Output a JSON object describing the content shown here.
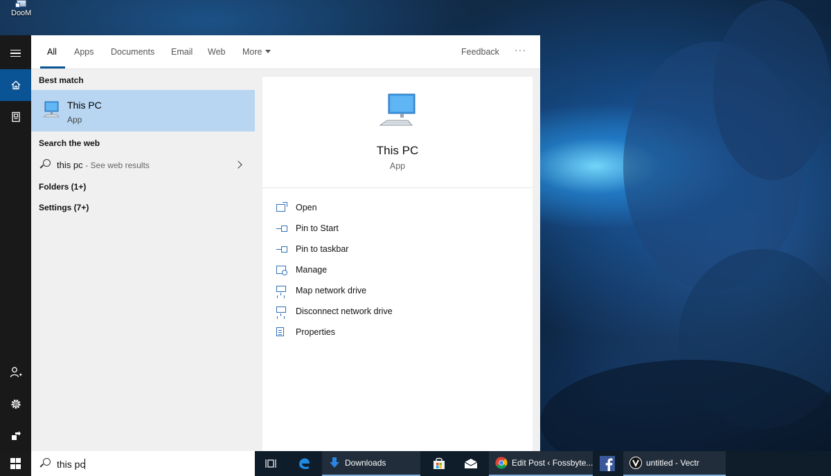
{
  "desktop": {
    "icons": [
      {
        "label": "DooM"
      }
    ]
  },
  "rail": {
    "items": [
      {
        "icon": "hamburger-icon"
      },
      {
        "icon": "home-icon",
        "active": true
      },
      {
        "icon": "notebook-icon"
      },
      {
        "icon": "add-user-icon"
      },
      {
        "icon": "gear-icon"
      },
      {
        "icon": "feedback-icon"
      }
    ]
  },
  "tabs": {
    "items": [
      {
        "label": "All",
        "active": true
      },
      {
        "label": "Apps"
      },
      {
        "label": "Documents"
      },
      {
        "label": "Email"
      },
      {
        "label": "Web"
      },
      {
        "label": "More"
      }
    ],
    "feedback_label": "Feedback",
    "overflow_label": "···"
  },
  "results": {
    "best_match_heading": "Best match",
    "best_match": {
      "name": "This PC",
      "type": "App"
    },
    "web_heading": "Search the web",
    "web_query": "this pc",
    "web_hint": "- See web results",
    "folders_label": "Folders (1+)",
    "settings_label": "Settings (7+)"
  },
  "detail": {
    "title": "This PC",
    "subtitle": "App",
    "actions": [
      {
        "label": "Open",
        "icon": "open-icon"
      },
      {
        "label": "Pin to Start",
        "icon": "pin-icon"
      },
      {
        "label": "Pin to taskbar",
        "icon": "pin-icon"
      },
      {
        "label": "Manage",
        "icon": "manage-icon"
      },
      {
        "label": "Map network drive",
        "icon": "network-drive-icon"
      },
      {
        "label": "Disconnect network drive",
        "icon": "network-drive-icon"
      },
      {
        "label": "Properties",
        "icon": "properties-icon"
      }
    ]
  },
  "taskbar": {
    "search_value": "this pc",
    "apps": [
      {
        "label": "Downloads",
        "icon": "download-arrow-icon"
      },
      {
        "label": "Edit Post ‹ Fossbyte...",
        "icon": "chrome-icon"
      },
      {
        "label": "untitled - Vectr",
        "icon": "vectr-icon"
      }
    ],
    "pinned": [
      "task-view-icon",
      "edge-icon",
      "store-icon",
      "mail-icon",
      "facebook-icon"
    ]
  },
  "colors": {
    "accent": "#0a5394",
    "selection": "#b8d6f2",
    "action_icon": "#2c6fb7",
    "taskbar": "#0f1c2a"
  }
}
